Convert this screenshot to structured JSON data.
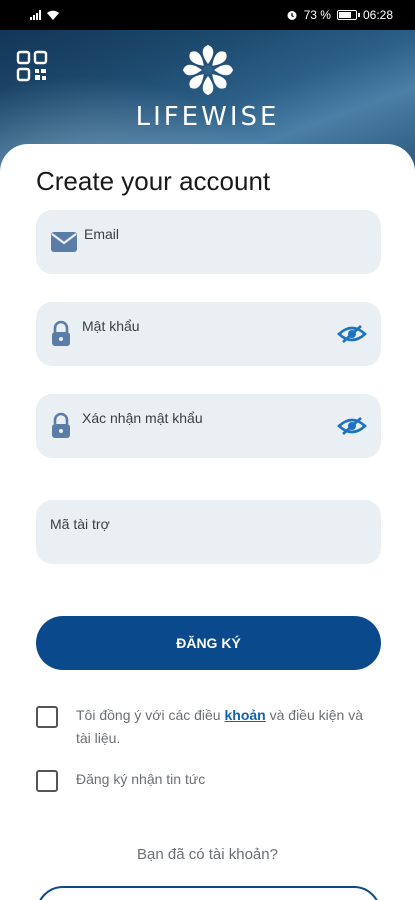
{
  "status_bar": {
    "battery": "73 %",
    "time": "06:28"
  },
  "header": {
    "brand": "LIFEWISE",
    "qr_icon": "qr-code-icon",
    "logo_icon": "lifewise-flower-logo"
  },
  "form": {
    "title": "Create your account",
    "fields": [
      {
        "label": "Email",
        "icon": "email-icon"
      },
      {
        "label": "Mật khẩu",
        "icon": "lock-icon",
        "toggle_icon": "eye-slash-icon"
      },
      {
        "label": "Xác nhận mật khẩu",
        "icon": "lock-icon",
        "toggle_icon": "eye-slash-icon"
      },
      {
        "label": "Mã tài trợ"
      }
    ],
    "submit_label": "ĐĂNG KÝ",
    "terms": {
      "before": "Tôi đồng ý với các điều ",
      "link": "khoản",
      "after": " và điều kiện và tài liệu."
    },
    "newsletter": "Đăng ký nhận tin tức",
    "have_account": "Bạn đã có tài khoản?"
  },
  "colors": {
    "primary": "#0a4a8c",
    "field_bg": "#e9eff3",
    "link": "#1363a6",
    "icon": "#5a7da8",
    "eye": "#1d72c2"
  }
}
